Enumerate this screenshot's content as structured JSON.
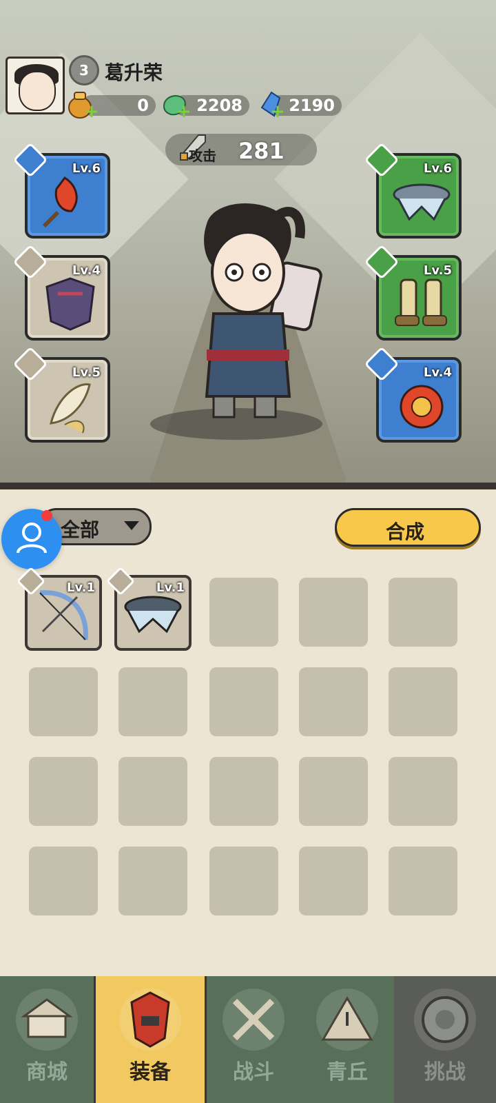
{
  "player": {
    "name": "葛升荣",
    "level": "3"
  },
  "resources": [
    {
      "name": "gold-pouch",
      "value": "0"
    },
    {
      "name": "jade-coin",
      "value": "2208"
    },
    {
      "name": "crystal",
      "value": "2190"
    }
  ],
  "attack": {
    "label": "攻击",
    "value": "281"
  },
  "equipped": {
    "left": [
      {
        "slot": "weapon",
        "level": "Lv.6",
        "rarity": "blue",
        "icon": "flame-flower-icon"
      },
      {
        "slot": "armor",
        "level": "Lv.4",
        "rarity": "gray",
        "icon": "armor-icon"
      },
      {
        "slot": "accessory",
        "level": "Lv.5",
        "rarity": "gray",
        "icon": "feather-wrap-icon"
      }
    ],
    "right": [
      {
        "slot": "belt",
        "level": "Lv.6",
        "rarity": "green",
        "icon": "belt-icon"
      },
      {
        "slot": "boots",
        "level": "Lv.5",
        "rarity": "green",
        "icon": "boots-icon"
      },
      {
        "slot": "charm",
        "level": "Lv.4",
        "rarity": "blue",
        "icon": "charm-icon"
      }
    ]
  },
  "inventory": {
    "filter": "全部",
    "synth_button": "合成",
    "items": [
      {
        "level": "Lv.1",
        "icon": "bow-icon"
      },
      {
        "level": "Lv.1",
        "icon": "belt-icon"
      }
    ]
  },
  "nav": [
    {
      "label": "商城",
      "icon": "shop-icon",
      "state": "normal"
    },
    {
      "label": "装备",
      "icon": "equipment-icon",
      "state": "active"
    },
    {
      "label": "战斗",
      "icon": "crossed-swords-icon",
      "state": "normal"
    },
    {
      "label": "青丘",
      "icon": "mountain-icon",
      "state": "normal"
    },
    {
      "label": "挑战",
      "icon": "challenge-orb-icon",
      "state": "locked"
    }
  ],
  "colors": {
    "rarity_blue": "#3f7fcf",
    "rarity_green": "#4aa046",
    "rarity_gray": "#cdc4b2",
    "accent_yellow": "#f7c84a",
    "nav_bg": "#58705a"
  }
}
